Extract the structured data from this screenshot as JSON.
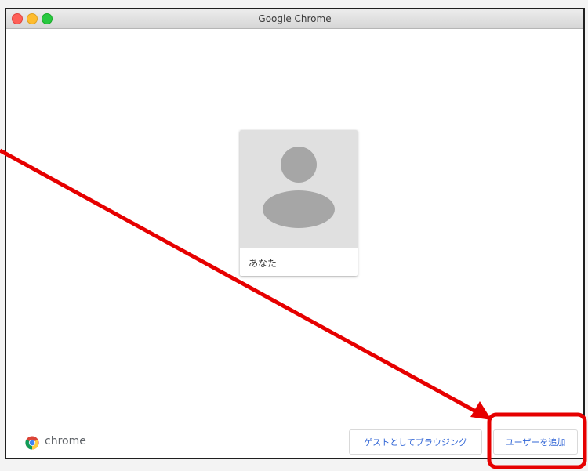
{
  "window": {
    "title": "Google Chrome"
  },
  "profile": {
    "name": "あなた"
  },
  "branding": {
    "wordmark": "chrome"
  },
  "buttons": {
    "guest": "ゲストとしてブラウジング",
    "add_user": "ユーザーを追加"
  },
  "icons": {
    "avatar": "default-avatar-icon",
    "logo": "chrome-logo-icon"
  },
  "annotation": {
    "color": "#e60000"
  }
}
